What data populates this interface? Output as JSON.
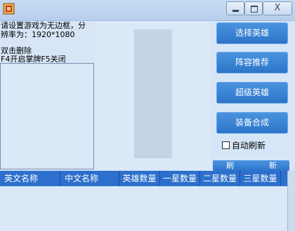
{
  "hints": {
    "line1": "请设置游戏为无边框，分",
    "line2": "辨率为：1920*1080",
    "line3": "双击删除",
    "line4": "F4开启掌牌F5关闭"
  },
  "buttons": {
    "select_hero": "选择英雄",
    "lineup_recommend": "阵容推荐",
    "super_hero": "超级英雄",
    "equipment_combine": "装备合成"
  },
  "auto_refresh": {
    "label": "自动刷新",
    "checked": false
  },
  "refresh": {
    "char1": "刷",
    "char2": "新"
  },
  "window_controls": {
    "close_symbol": "X"
  },
  "table": {
    "columns": [
      "英文名称",
      "中文名称",
      "英雄数量",
      "一星数量",
      "二星数量",
      "三星数量"
    ],
    "rows": []
  },
  "colors": {
    "accent": "#2d74c8",
    "header": "#2d6fcc",
    "background": "#d6e6f8"
  }
}
